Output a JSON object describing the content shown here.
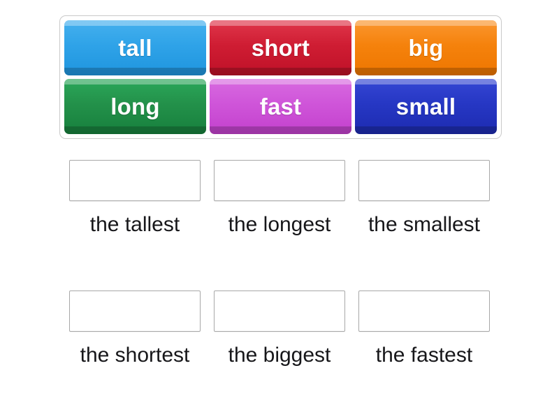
{
  "activity": {
    "type": "drag-and-drop-match",
    "background_color": "#ffffff"
  },
  "tile_tray": {
    "border_color": "#c9c9c9",
    "tiles": [
      {
        "label": "tall",
        "color_top": "#45b0ee",
        "color_bottom": "#1f95de",
        "color": "#2fa3e8"
      },
      {
        "label": "short",
        "color_top": "#e0364b",
        "color_bottom": "#bf1128",
        "color": "#cf1d33"
      },
      {
        "label": "big",
        "color_top": "#fb9730",
        "color_bottom": "#ee7600",
        "color": "#f5820c"
      },
      {
        "label": "long",
        "color_top": "#2ba85a",
        "color_bottom": "#17803d",
        "color": "#23914a"
      },
      {
        "label": "fast",
        "color_top": "#d86ae0",
        "color_bottom": "#c341cd",
        "color": "#cf55d9"
      },
      {
        "label": "small",
        "color_top": "#3546d4",
        "color_bottom": "#1d2bb0",
        "color": "#2637c4"
      }
    ]
  },
  "slots": {
    "box_border_color": "#a8a8a8",
    "label_color": "#17171a",
    "items": [
      {
        "label": "the tallest",
        "value": ""
      },
      {
        "label": "the longest",
        "value": ""
      },
      {
        "label": "the smallest",
        "value": ""
      },
      {
        "label": "the shortest",
        "value": ""
      },
      {
        "label": "the biggest",
        "value": ""
      },
      {
        "label": "the fastest",
        "value": ""
      }
    ]
  }
}
